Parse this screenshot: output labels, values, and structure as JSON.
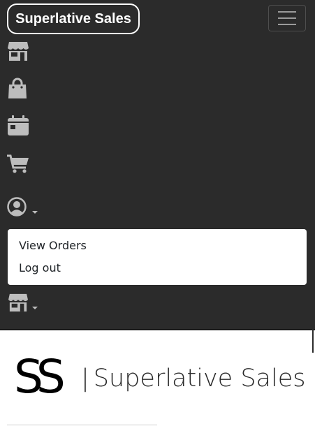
{
  "navbar": {
    "brand": "Superlative Sales",
    "toggler_icon": "hamburger-icon",
    "items": [
      {
        "icon": "store-icon"
      },
      {
        "icon": "shopping-bag-icon"
      },
      {
        "icon": "calendar-icon"
      },
      {
        "icon": "cart-icon"
      },
      {
        "icon": "user-circle-icon",
        "has_dropdown": true
      },
      {
        "icon": "store-icon",
        "has_dropdown": true
      }
    ],
    "colors": {
      "background": "#2b2b2b",
      "icon": "#bdbdbd",
      "brand_text": "#ffffff"
    }
  },
  "user_dropdown": {
    "items": [
      "View Orders",
      "Log out"
    ]
  },
  "logo": {
    "mark": "SS",
    "separator": "|",
    "text": "Superlative Sales"
  }
}
